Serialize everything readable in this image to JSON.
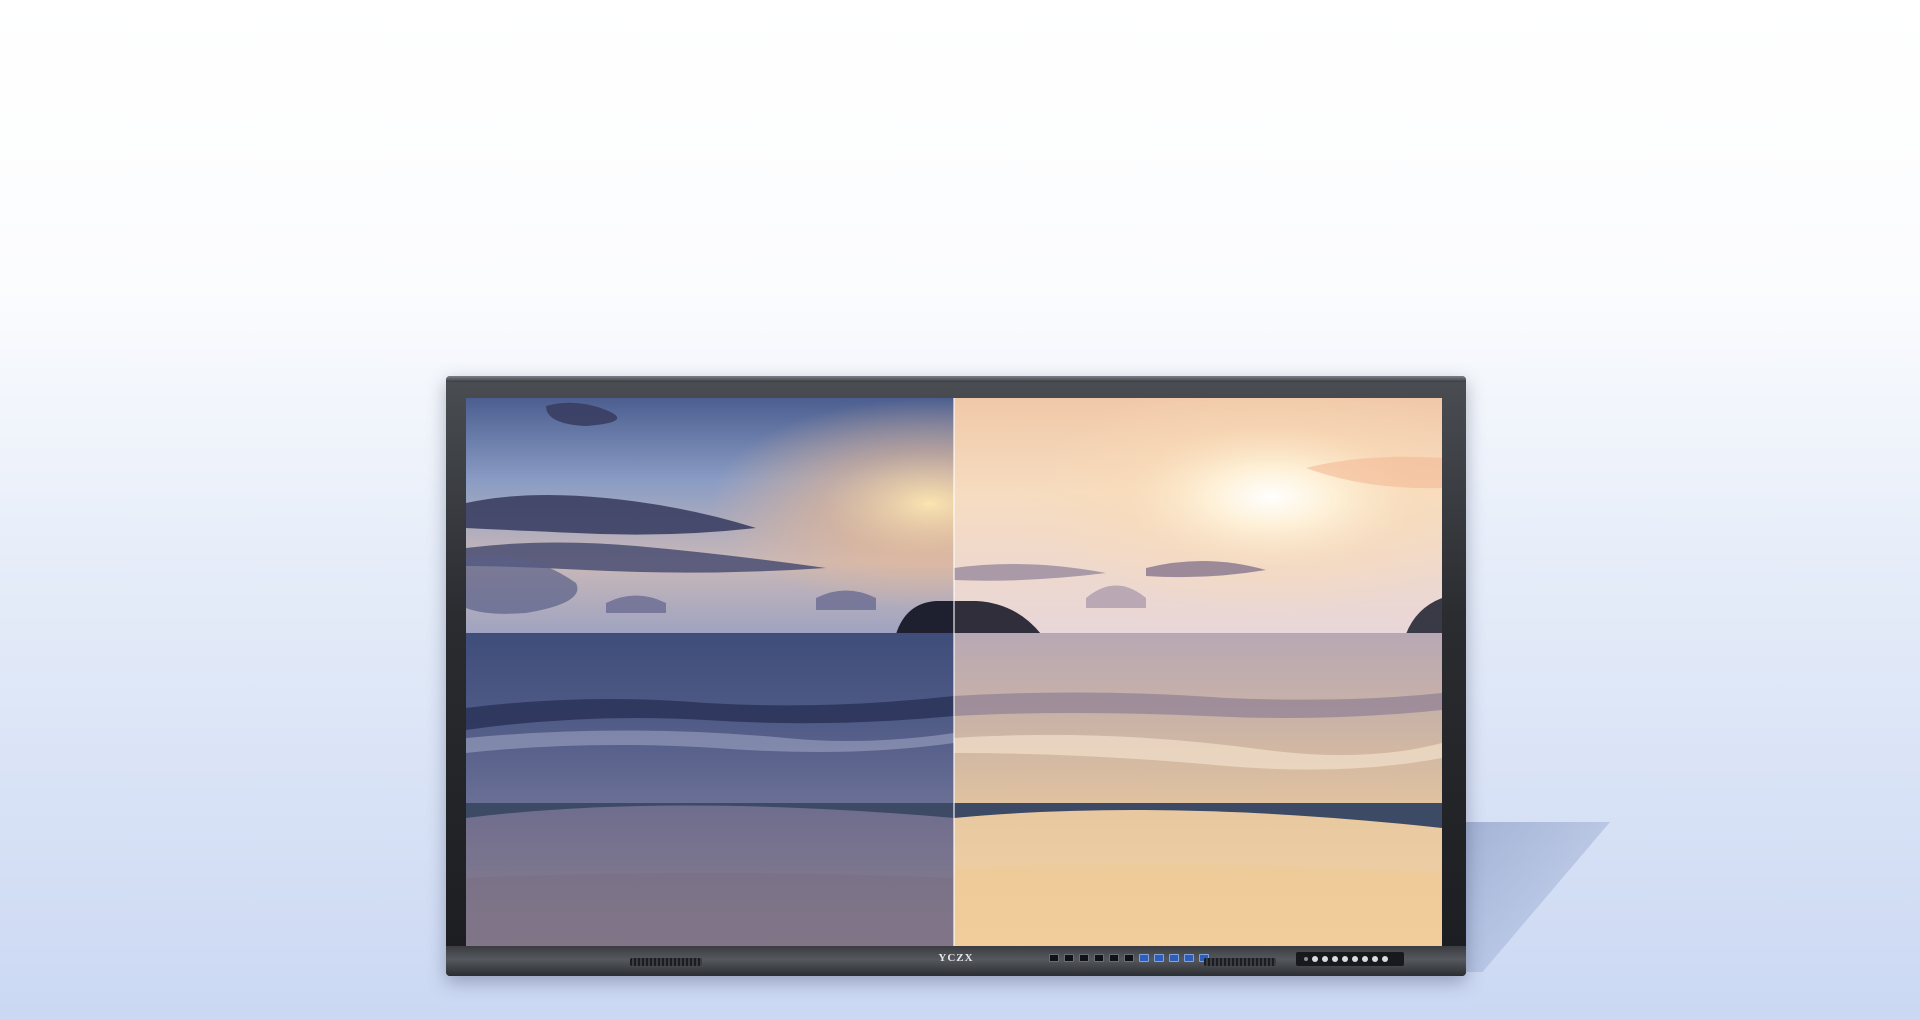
{
  "product": {
    "brand_label": "YCZX",
    "icons": {
      "comparison": "split-screen-comparison",
      "ports": "io-port-icon",
      "buttons": "control-button-icon"
    },
    "colors": {
      "background_top": "#ffffff",
      "background_bottom": "#cbd8f3",
      "bezel": "#2a2c30",
      "usb3_accent": "#2d5fb8"
    },
    "port_count": 11,
    "button_count": 9
  }
}
